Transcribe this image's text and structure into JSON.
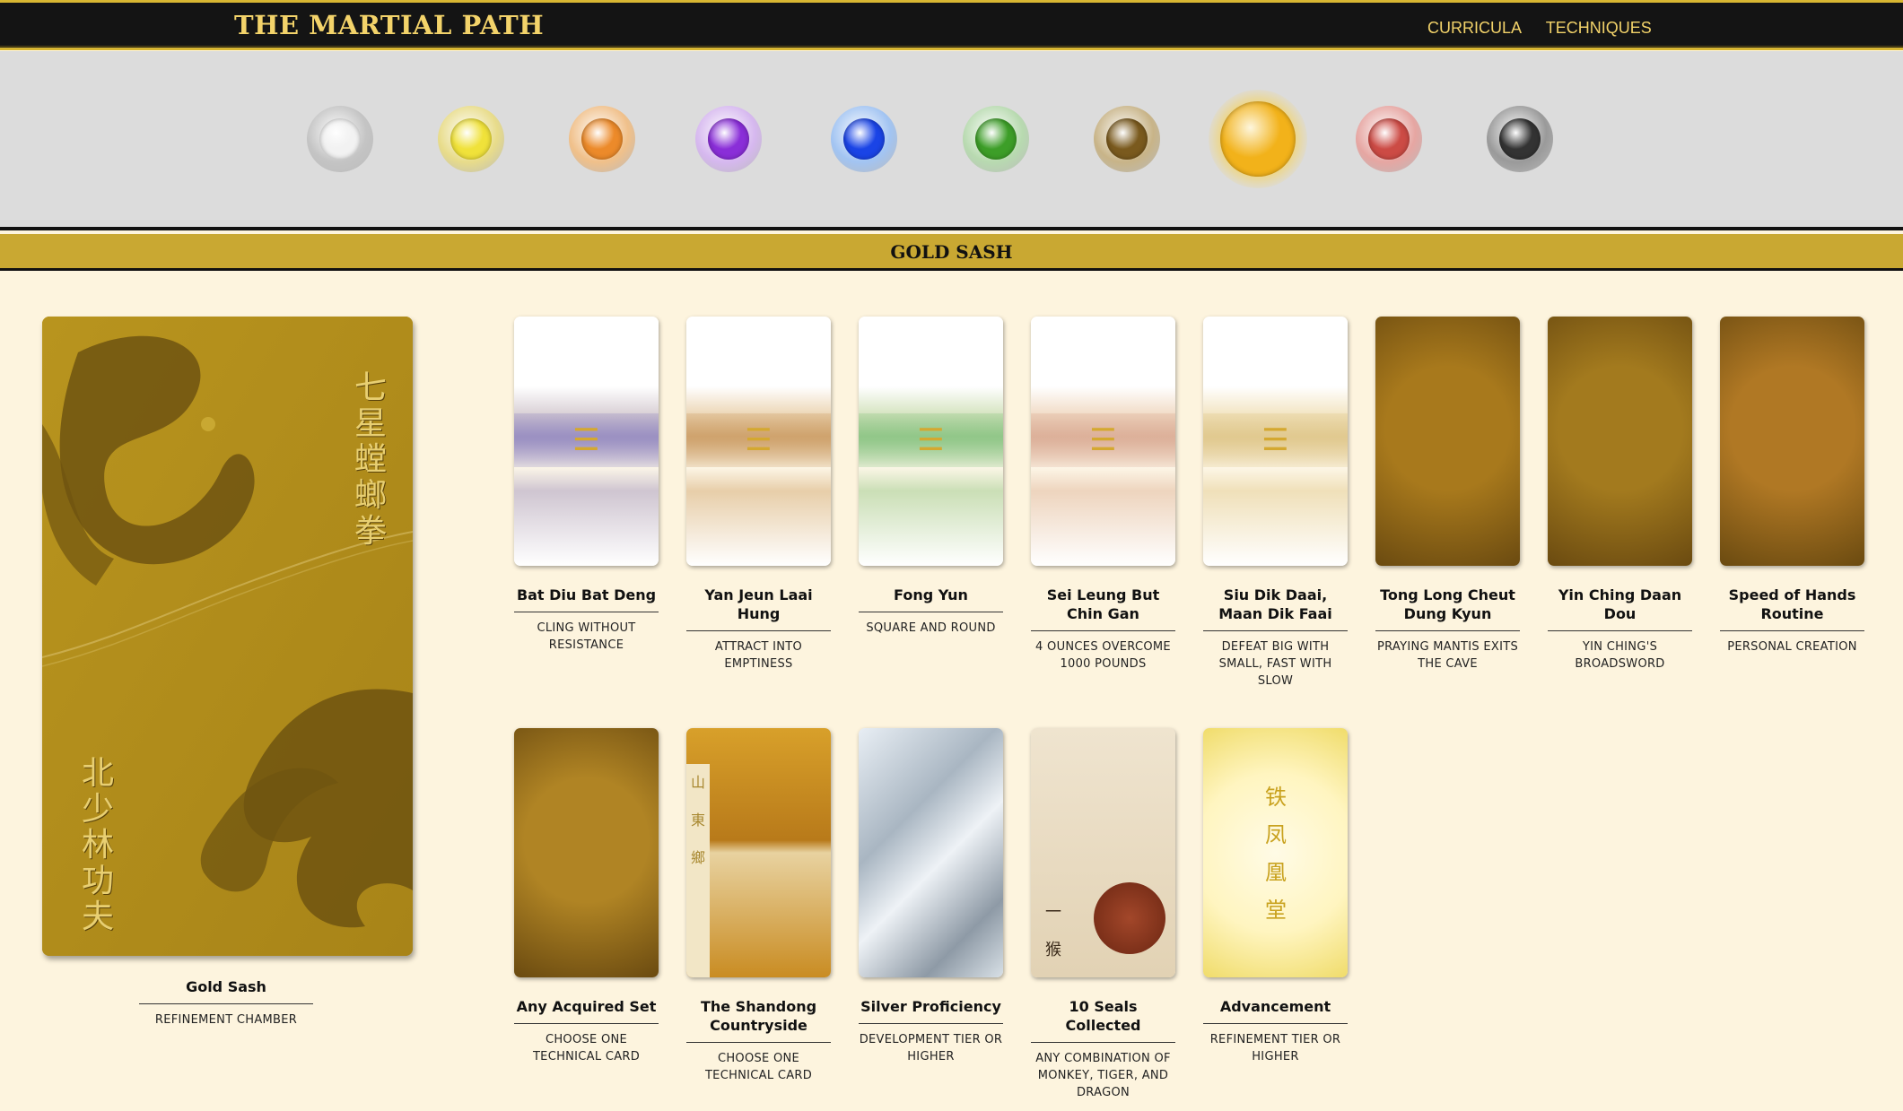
{
  "header": {
    "brand": "THE MARTIAL PATH",
    "nav": [
      "CURRICULA",
      "TECHNIQUES"
    ]
  },
  "belts": [
    {
      "name": "white-belt-orb",
      "color": "#f2f2f2",
      "rim": "#c4c4c4"
    },
    {
      "name": "yellow-belt-orb",
      "color": "#f0e23a",
      "rim": "#e8dc8a"
    },
    {
      "name": "orange-belt-orb",
      "color": "#ec8a2a",
      "rim": "#f0c08a"
    },
    {
      "name": "purple-belt-orb",
      "color": "#8a2ed8",
      "rim": "#d6b8ef"
    },
    {
      "name": "blue-belt-orb",
      "color": "#1a44e6",
      "rim": "#a2c4f2"
    },
    {
      "name": "green-belt-orb",
      "color": "#3d9e28",
      "rim": "#b8dab0"
    },
    {
      "name": "brown-belt-orb",
      "color": "#7a5a1e",
      "rim": "#c8b488"
    },
    {
      "name": "gold-belt-orb",
      "color": "#f2b21a",
      "rim": "#f7d35a",
      "selected": true
    },
    {
      "name": "red-belt-orb",
      "color": "#cc4b45",
      "rim": "#e6a6a2"
    },
    {
      "name": "black-belt-orb",
      "color": "#333333",
      "rim": "#9a9a9a"
    }
  ],
  "section_title": "GOLD SASH",
  "main_card": {
    "title": "Gold Sash",
    "subtitle": "REFINEMENT CHAMBER",
    "glyphs_right": "七星螳螂拳",
    "glyphs_left": "北少林功夫"
  },
  "cards_row1": [
    {
      "title": "Bat Diu Bat Deng",
      "subtitle": "CLING WITHOUT RESISTANCE",
      "tint": "#8a7fbd"
    },
    {
      "title": "Yan Jeun Laai Hung",
      "subtitle": "ATTRACT INTO EMPTINESS",
      "tint": "#c7955a"
    },
    {
      "title": "Fong Yun",
      "subtitle": "SQUARE AND ROUND",
      "tint": "#7fbf7a"
    },
    {
      "title": "Sei Leung But Chin Gan",
      "subtitle": "4 OUNCES OVERCOME 1000 POUNDS",
      "tint": "#d7a58e"
    },
    {
      "title": "Siu Dik Daai, Maan Dik Faai",
      "subtitle": "DEFEAT BIG WITH SMALL, FAST WITH SLOW",
      "tint": "#dcc282"
    },
    {
      "title": "Tong Long Cheut Dung Kyun",
      "subtitle": "PRAYING MANTIS EXITS THE CAVE",
      "tint": "#a8791c"
    },
    {
      "title": "Yin Ching Daan Dou",
      "subtitle": "YIN CHING'S BROADSWORD",
      "tint": "#a37a1e"
    },
    {
      "title": "Speed of Hands Routine",
      "subtitle": "PERSONAL CREATION",
      "tint": "#b07824"
    }
  ],
  "cards_row2": [
    {
      "title": "Any Acquired Set",
      "subtitle": "CHOOSE ONE TECHNICAL CARD",
      "tint": "#b08424"
    },
    {
      "title": "The Shandong Countryside",
      "subtitle": "CHOOSE ONE TECHNICAL CARD",
      "tint": "#d8a02a",
      "glyphs": "山東鄉"
    },
    {
      "title": "Silver Proficiency",
      "subtitle": "DEVELOPMENT TIER OR HIGHER",
      "tint": "#b6c2cc"
    },
    {
      "title": "10 Seals Collected",
      "subtitle": "ANY COMBINATION OF MONKEY, TIGER, AND DRAGON",
      "tint": "#e0d2b8",
      "glyphs": "一猴"
    },
    {
      "title": "Advancement",
      "subtitle": "REFINEMENT TIER OR HIGHER",
      "tint": "#f5eb9a",
      "glyphs": "铁凤凰堂"
    }
  ]
}
